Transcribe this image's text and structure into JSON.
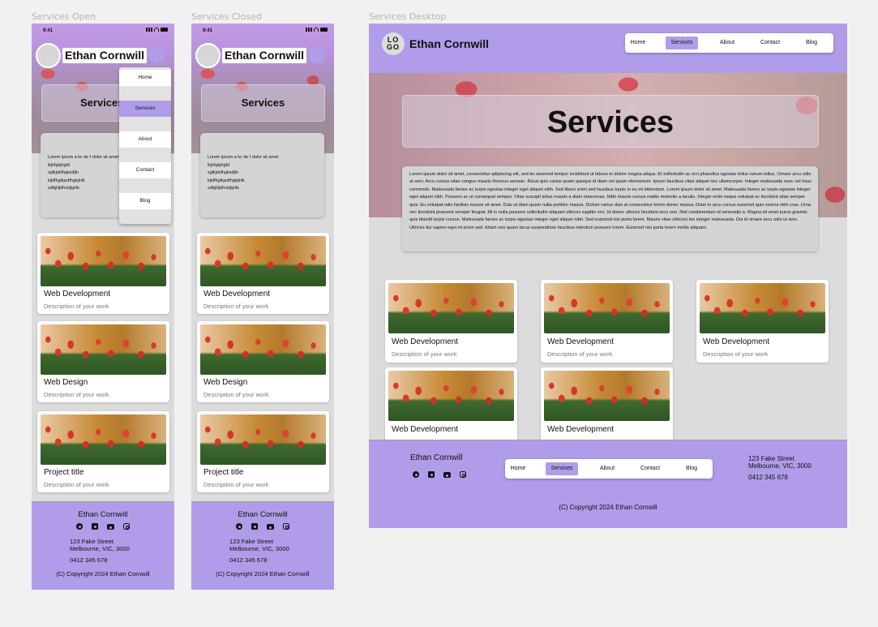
{
  "frames": {
    "open_label": "Services Open",
    "closed_label": "Services Closed",
    "desktop_label": "Services Desktop"
  },
  "site": {
    "name": "Ethan Cornwill",
    "logo_text": "LOGO",
    "page_title": "Services"
  },
  "status_bar": {
    "time": "9:41"
  },
  "nav": {
    "items": [
      "Home",
      "Services",
      "About",
      "Contact",
      "Blog"
    ],
    "active": "Services"
  },
  "mobile_description": "Lorem ipsum a bc de f dolor sit amet\nlkjhfgkjhgfd\nsglkjdsfhgksdjfn\nkjldfhglkjsdfhgkjlnlk\nsdfgkljdhskjlgnlk",
  "desktop_description": "Lorem ipsum dolor sit amet, consectetur adipiscing elit, sed do eiusmod tempor incididunt ut labore et dolore magna aliqua. Et sollicitudin ac orci phasellus egestas tellus rutrum tellus. Ornare arcu odio ut sem. Arcu cursus vitae congue mauris rhoncus aenean. Risus quis varius quam quisque id diam vel quam elementum. Ipsum faucibus vitae aliquet nec ullamcorper. Integer malesuada nunc vel risus commodo. Malesuada fames ac turpis egestas integer eget aliquet nibh. Sed libero enim sed faucibus turpis in eu mi bibendum. Lorem ipsum dolor sit amet. Malesuada fames ac turpis egestas integer eget aliquet nibh. Posuere ac ut consequat semper. Vitae suscipit tellus mauris a diam maecenas. Nibh mauris cursus mattis molestie a iaculis. Integer enim neque volutpat ac tincidunt vitae semper quis. Eu volutpat odio facilisis mauris sit amet. Duis ut diam quam nulla porttitor massa. Dictum varius duis at consectetur lorem donec massa. Diam in arcu cursus euismod quis viverra nibh cras. Urna nec tincidunt praesent semper feugiat. Mi in nulla posuere sollicitudin aliquam ultrices sagittis orci. Id donec ultrices tincidunt arcu non. Nisl condimentum id venenatis a. Magna sit amet purus gravida quis blandit turpis cursus. Malesuada fames ac turpis egestas integer eget aliquet nibh. Sed euismod nisi porta lorem. Mauris vitae ultricies leo integer malesuada. Dui id ornare arcu odio ut sem. Ultrices dui sapien eget mi proin sed. Etiam non quam lacus suspendisse faucibus interdum posuere lorem. Euismod nisi porta lorem mollis aliquam.",
  "mobile_cards": [
    {
      "title": "Web Development",
      "description": "Description of your work"
    },
    {
      "title": "Web Design",
      "description": "Description of your work"
    },
    {
      "title": "Project title",
      "description": "Description of your work"
    }
  ],
  "desktop_cards": [
    {
      "title": "Web Development",
      "description": "Description of your work"
    },
    {
      "title": "Web Development",
      "description": "Description of your work"
    },
    {
      "title": "Web Development",
      "description": "Description of your work"
    },
    {
      "title": "Web Development",
      "description": ""
    },
    {
      "title": "Web Development",
      "description": ""
    }
  ],
  "footer": {
    "name": "Ethan Cornwill",
    "address_line1": "123 Fake Street",
    "address_line2": "Melbourne, VIC, 3000",
    "phone": "0412 345 678",
    "copyright": "(C) Copyright 2024 Ethan Cornwill",
    "socials": [
      "facebook-icon",
      "linkedin-icon",
      "youtube-icon",
      "instagram-icon"
    ]
  },
  "colors": {
    "accent": "#b09ce8",
    "surface": "#dcdcdc",
    "card": "#ffffff",
    "muted_text": "#777777"
  }
}
